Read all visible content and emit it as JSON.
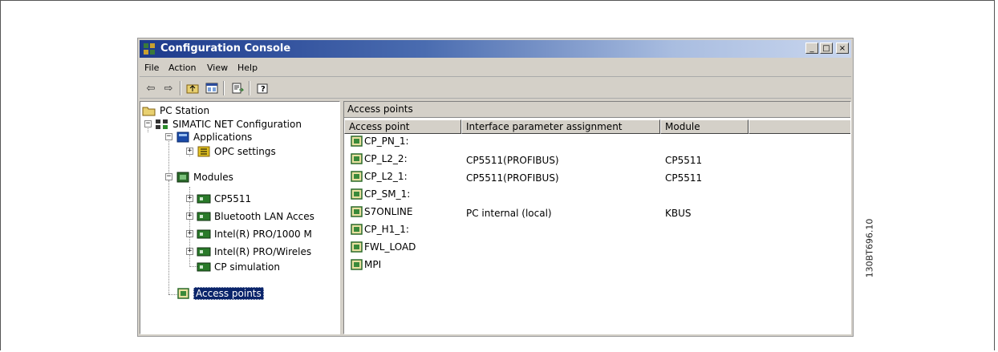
{
  "window": {
    "title": "Configuration Console",
    "controls": [
      "_",
      "□",
      "×"
    ]
  },
  "menu": {
    "items": [
      {
        "label": "File"
      },
      {
        "label": "Action"
      },
      {
        "label": "View"
      },
      {
        "label": "Help"
      }
    ]
  },
  "toolbar": {
    "buttons": [
      "back-arrow-icon",
      "forward-arrow-icon",
      "up-folder-icon",
      "show-hide-tree-icon",
      "export-list-icon",
      "help-icon"
    ]
  },
  "tree": {
    "root": "PC Station",
    "simatic": "SIMATIC NET Configuration",
    "applications": "Applications",
    "opc_settings": "OPC settings",
    "modules": "Modules",
    "module_items": [
      "CP5511",
      "Bluetooth LAN Acces",
      "Intel(R) PRO/1000 M",
      "Intel(R) PRO/Wireles",
      "CP simulation"
    ],
    "access_points": "Access points"
  },
  "right_pane": {
    "header": "Access points",
    "columns": [
      "Access point",
      "Interface parameter assignment",
      "Module"
    ],
    "rows": [
      {
        "access_point": "CP_PN_1:",
        "interface": "",
        "module": ""
      },
      {
        "access_point": "CP_L2_2:",
        "interface": "CP5511(PROFIBUS)",
        "module": "CP5511"
      },
      {
        "access_point": "CP_L2_1:",
        "interface": "CP5511(PROFIBUS)",
        "module": "CP5511"
      },
      {
        "access_point": "CP_SM_1:",
        "interface": "",
        "module": ""
      },
      {
        "access_point": "S7ONLINE",
        "interface": "PC internal (local)",
        "module": "KBUS"
      },
      {
        "access_point": "CP_H1_1:",
        "interface": "",
        "module": ""
      },
      {
        "access_point": "FWL_LOAD",
        "interface": "",
        "module": ""
      },
      {
        "access_point": "MPI",
        "interface": "",
        "module": ""
      }
    ]
  },
  "figure_id": "130BT696.10",
  "colors": {
    "title_gradient_start": "#1d3a8c",
    "title_gradient_end": "#c9d6ee",
    "face": "#d4d0c8",
    "selection": "#0a246a"
  }
}
